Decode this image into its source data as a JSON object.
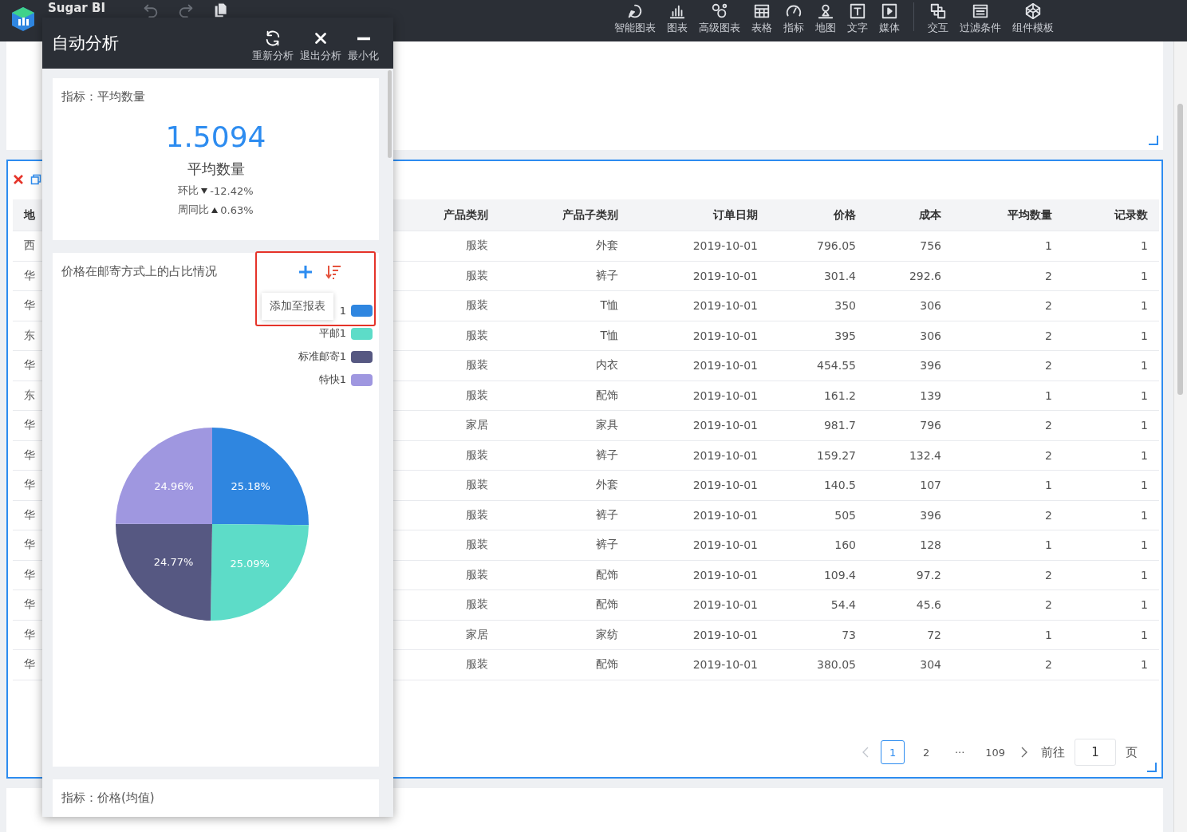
{
  "app": {
    "name": "Sugar BI"
  },
  "toolbar": [
    {
      "label": "智能图表"
    },
    {
      "label": "图表"
    },
    {
      "label": "高级图表"
    },
    {
      "label": "表格"
    },
    {
      "label": "指标"
    },
    {
      "label": "地图"
    },
    {
      "label": "文字"
    },
    {
      "label": "媒体"
    },
    {
      "label": "交互"
    },
    {
      "label": "过滤条件"
    },
    {
      "label": "组件模板"
    }
  ],
  "panel": {
    "title": "自动分析",
    "actions": [
      {
        "label": "重新分析"
      },
      {
        "label": "退出分析"
      },
      {
        "label": "最小化"
      }
    ],
    "metric_card": {
      "heading": "指标：平均数量",
      "value": "1.5094",
      "label": "平均数量",
      "comparisons": [
        {
          "label": "环比",
          "kind": "down",
          "value": "-12.42%"
        },
        {
          "label": "周同比",
          "kind": "up",
          "value": "0.63%"
        }
      ]
    },
    "chart_card": {
      "title": "价格在邮寄方式上的占比情况",
      "tooltip": "添加至报表",
      "legend": [
        {
          "label": "1",
          "color": "#2f86e0"
        },
        {
          "label": "平邮1",
          "color": "#5ddcc8"
        },
        {
          "label": "标准邮寄1",
          "color": "#565882"
        },
        {
          "label": "特快1",
          "color": "#9f97e0"
        }
      ],
      "chart_data": {
        "type": "pie",
        "values": [
          25.18,
          25.09,
          24.77,
          24.96
        ],
        "value_labels": [
          "25.18%",
          "25.09%",
          "24.77%",
          "24.96%"
        ]
      }
    },
    "next_card": {
      "heading": "指标：价格(均值)"
    }
  },
  "table": {
    "columns": [
      "地",
      "产品类别",
      "产品子类别",
      "订单日期",
      "价格",
      "成本",
      "平均数量",
      "记录数"
    ],
    "rows": [
      [
        "西",
        "服装",
        "外套",
        "2019-10-01",
        "796.05",
        "756",
        "1",
        "1"
      ],
      [
        "华",
        "服装",
        "裤子",
        "2019-10-01",
        "301.4",
        "292.6",
        "2",
        "1"
      ],
      [
        "华",
        "服装",
        "T恤",
        "2019-10-01",
        "350",
        "306",
        "2",
        "1"
      ],
      [
        "东",
        "服装",
        "T恤",
        "2019-10-01",
        "395",
        "306",
        "2",
        "1"
      ],
      [
        "华",
        "服装",
        "内衣",
        "2019-10-01",
        "454.55",
        "396",
        "2",
        "1"
      ],
      [
        "东",
        "服装",
        "配饰",
        "2019-10-01",
        "161.2",
        "139",
        "1",
        "1"
      ],
      [
        "华",
        "家居",
        "家具",
        "2019-10-01",
        "981.7",
        "796",
        "2",
        "1"
      ],
      [
        "华",
        "服装",
        "裤子",
        "2019-10-01",
        "159.27",
        "132.4",
        "2",
        "1"
      ],
      [
        "华",
        "服装",
        "外套",
        "2019-10-01",
        "140.5",
        "107",
        "1",
        "1"
      ],
      [
        "华",
        "服装",
        "裤子",
        "2019-10-01",
        "505",
        "396",
        "2",
        "1"
      ],
      [
        "华",
        "服装",
        "裤子",
        "2019-10-01",
        "160",
        "128",
        "1",
        "1"
      ],
      [
        "华",
        "服装",
        "配饰",
        "2019-10-01",
        "109.4",
        "97.2",
        "2",
        "1"
      ],
      [
        "华",
        "服装",
        "配饰",
        "2019-10-01",
        "54.4",
        "45.6",
        "2",
        "1"
      ],
      [
        "华",
        "家居",
        "家纺",
        "2019-10-01",
        "73",
        "72",
        "1",
        "1"
      ],
      [
        "华",
        "服装",
        "配饰",
        "2019-10-01",
        "380.05",
        "304",
        "2",
        "1"
      ]
    ]
  },
  "pagination": {
    "pages": [
      {
        "label": "1",
        "selected": true
      },
      {
        "label": "2",
        "selected": false
      },
      {
        "label": "···",
        "selected": false
      },
      {
        "label": "109",
        "selected": false
      }
    ],
    "goto_label": "前往",
    "goto_value": "1",
    "page_unit": "页"
  }
}
